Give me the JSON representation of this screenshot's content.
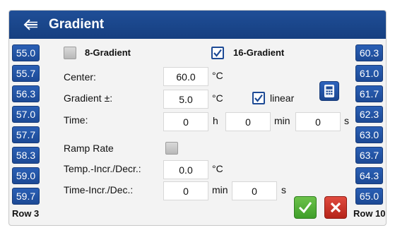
{
  "header": {
    "title": "Gradient",
    "back_icon": "back-arrow-icon"
  },
  "left_column": {
    "values": [
      "55.0",
      "55.7",
      "56.3",
      "57.0",
      "57.7",
      "58.3",
      "59.0",
      "59.7"
    ],
    "row_label": "Row 3"
  },
  "right_column": {
    "values": [
      "60.3",
      "61.0",
      "61.7",
      "62.3",
      "63.0",
      "63.7",
      "64.3",
      "65.0"
    ],
    "row_label": "Row 10"
  },
  "mode": {
    "eight": {
      "label": "8-Gradient",
      "checked": false
    },
    "sixteen": {
      "label": "16-Gradient",
      "checked": true
    }
  },
  "center": {
    "label": "Center:",
    "value": "60.0",
    "unit": "°C"
  },
  "gradient": {
    "label": "Gradient ±:",
    "value": "5.0",
    "unit": "°C",
    "linear_label": "linear",
    "linear_checked": true
  },
  "time": {
    "label": "Time:",
    "hours": "0",
    "h_unit": "h",
    "minutes": "0",
    "min_unit": "min",
    "seconds": "0",
    "s_unit": "s"
  },
  "ramp": {
    "label": "Ramp Rate",
    "checked": false
  },
  "temp_incr": {
    "label": "Temp.-Incr./Decr.:",
    "value": "0.0",
    "unit": "°C"
  },
  "time_incr": {
    "label": "Time-Incr./Dec.:",
    "minutes": "0",
    "min_unit": "min",
    "seconds": "0",
    "s_unit": "s"
  },
  "icons": {
    "calculator": "calculator-icon",
    "ok": "check-icon",
    "cancel": "close-icon"
  },
  "colors": {
    "header": "#1f4e97",
    "chip": "#2a5fb5",
    "ok": "#4caf36",
    "cancel": "#c8342a"
  }
}
